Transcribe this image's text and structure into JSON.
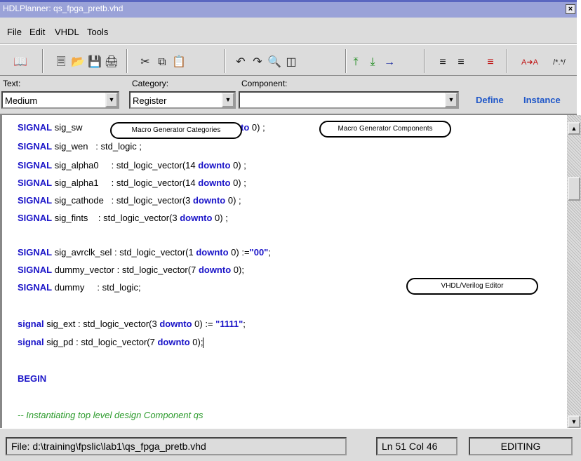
{
  "window": {
    "title": "HDLPlanner: qs_fpga_pretb.vhd",
    "close_label": "×"
  },
  "menu": [
    {
      "label": "File"
    },
    {
      "label": "Edit"
    },
    {
      "label": "VHDL"
    },
    {
      "label": "Tools"
    }
  ],
  "toolbar": {
    "icons": [
      "book-icon",
      "new-file-icon",
      "open-folder-icon",
      "save-icon",
      "print-icon",
      "cut-icon",
      "copy-icon",
      "paste-icon",
      "undo-icon",
      "redo-icon",
      "find-icon",
      "replace-icon",
      "move-top-icon",
      "move-down-icon",
      "goto-icon",
      "indent-icon",
      "outdent-icon",
      "insert-icon",
      "font-format-icon",
      "comment-icon"
    ]
  },
  "selectors": {
    "text_label": "Text:",
    "text_value": "Medium",
    "category_label": "Category:",
    "category_value": "Register",
    "component_label": "Component:",
    "component_value": "",
    "define_label": "Define",
    "instance_label": "Instance"
  },
  "callouts": {
    "categories": "Macro Generator Categories",
    "components": "Macro Generator Components",
    "editor": "VHDL/Verilog Editor"
  },
  "code": {
    "l1": {
      "kw": "SIGNAL",
      "a": " sig_sw ",
      "hidden": "",
      "b": "downto",
      "c": " 0) ;"
    },
    "l2": {
      "kw": "SIGNAL",
      "a": " sig_wen   : std_logic ;"
    },
    "l3": {
      "kw": "SIGNAL",
      "a": " sig_alpha0     : std_logic_vector(14 ",
      "b": "downto",
      "c": " 0) ;"
    },
    "l4": {
      "kw": "SIGNAL",
      "a": " sig_alpha1     : std_logic_vector(14 ",
      "b": "downto",
      "c": " 0) ;"
    },
    "l5": {
      "kw": "SIGNAL",
      "a": " sig_cathode   : std_logic_vector(3 ",
      "b": "downto",
      "c": " 0) ;"
    },
    "l6": {
      "kw": "SIGNAL",
      "a": " sig_fints    : std_logic_vector(3 ",
      "b": "downto",
      "c": " 0) ;"
    },
    "l7": {
      "kw": "SIGNAL",
      "a": " sig_avrclk_sel : std_logic_vector(1 ",
      "b": "downto",
      "c": " 0) :=",
      "s": "\"00\"",
      "d": ";"
    },
    "l8": {
      "kw": "SIGNAL",
      "a": " dummy_vector : std_logic_vector(7 ",
      "b": "downto",
      "c": " 0);"
    },
    "l9": {
      "kw": "SIGNAL",
      "a": " dummy     : std_logic;"
    },
    "l10": {
      "kw": "signal",
      "a": " sig_ext : std_logic_vector(3 ",
      "b": "downto",
      "c": " 0) := ",
      "s": "\"1111\"",
      "d": ";"
    },
    "l11": {
      "kw": "signal",
      "a": " sig_pd : std_logic_vector(7 ",
      "b": "downto",
      "c": " 0);"
    },
    "l12": {
      "kw": "BEGIN"
    },
    "l13": {
      "cmt": "-- Instantiating top level design Component qs"
    }
  },
  "status": {
    "file": "File: d:\\training\\fpslic\\lab1\\qs_fpga_pretb.vhd",
    "position": "Ln 51  Col 46",
    "mode": "EDITING"
  }
}
